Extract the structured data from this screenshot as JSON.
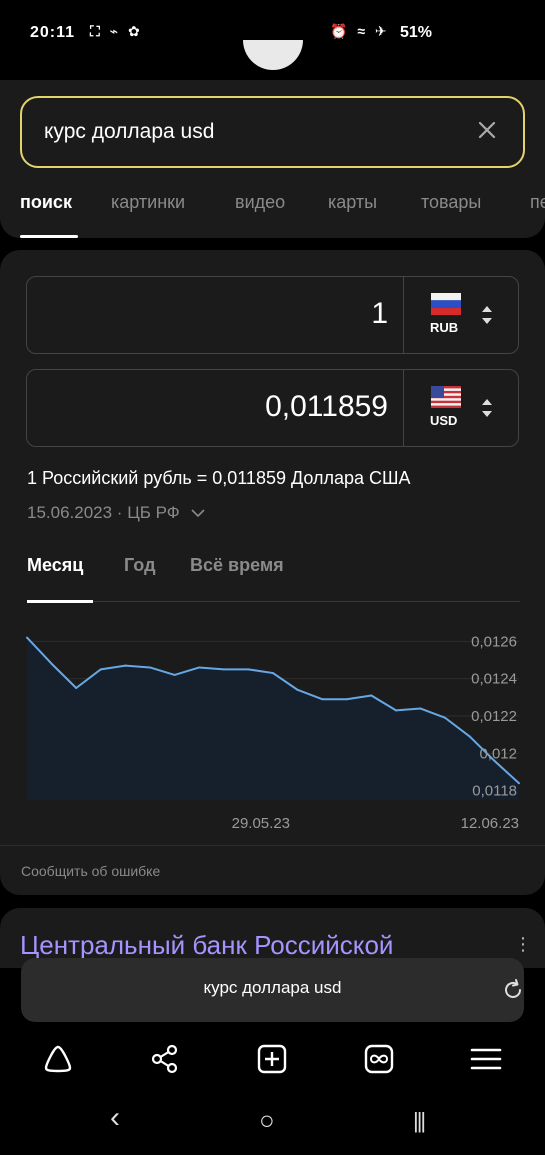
{
  "status_bar": {
    "time": "20:11",
    "left_icons": "⛶ ⌁ ✿",
    "right_icons": "⏰ ≈ ✈",
    "battery": "51%"
  },
  "search": {
    "query": "курс доллара usd"
  },
  "tabs": [
    "поиск",
    "картинки",
    "видео",
    "карты",
    "товары",
    "пе"
  ],
  "converter": {
    "from": {
      "amount": "1",
      "code": "RUB"
    },
    "to": {
      "amount": "0,011859",
      "code": "USD"
    },
    "rate_text": "1 Российский рубль = 0,011859 Доллара США",
    "date_source": "15.06.2023 · ЦБ РФ"
  },
  "periods": [
    "Месяц",
    "Год",
    "Всё время"
  ],
  "chart_data": {
    "type": "line",
    "title": "",
    "x_ticks": [
      "29.05.23",
      "12.06.23"
    ],
    "y_ticks": [
      "0,0126",
      "0,0124",
      "0,0122",
      "0,012",
      "0,0118"
    ],
    "ylim": [
      0.01175,
      0.01265
    ],
    "grid": true,
    "values": [
      0.01262,
      0.01248,
      0.01235,
      0.01245,
      0.01247,
      0.01246,
      0.01242,
      0.01246,
      0.01245,
      0.01245,
      0.01243,
      0.01234,
      0.01229,
      0.01229,
      0.01231,
      0.01223,
      0.01224,
      0.01219,
      0.01209,
      0.01196,
      0.01184
    ],
    "colors": {
      "line": "#66a8e6",
      "fill": "#16202c"
    }
  },
  "report_link": "Сообщить об ошибке",
  "next_result_title": "Центральный банк Российской",
  "bottom_search_text": "курс доллара usd",
  "nav_icons": [
    "alice-icon",
    "share-icon",
    "new-tab-icon",
    "tabs-icon",
    "menu-icon"
  ],
  "system_nav": [
    "‹",
    "○",
    "|||"
  ]
}
